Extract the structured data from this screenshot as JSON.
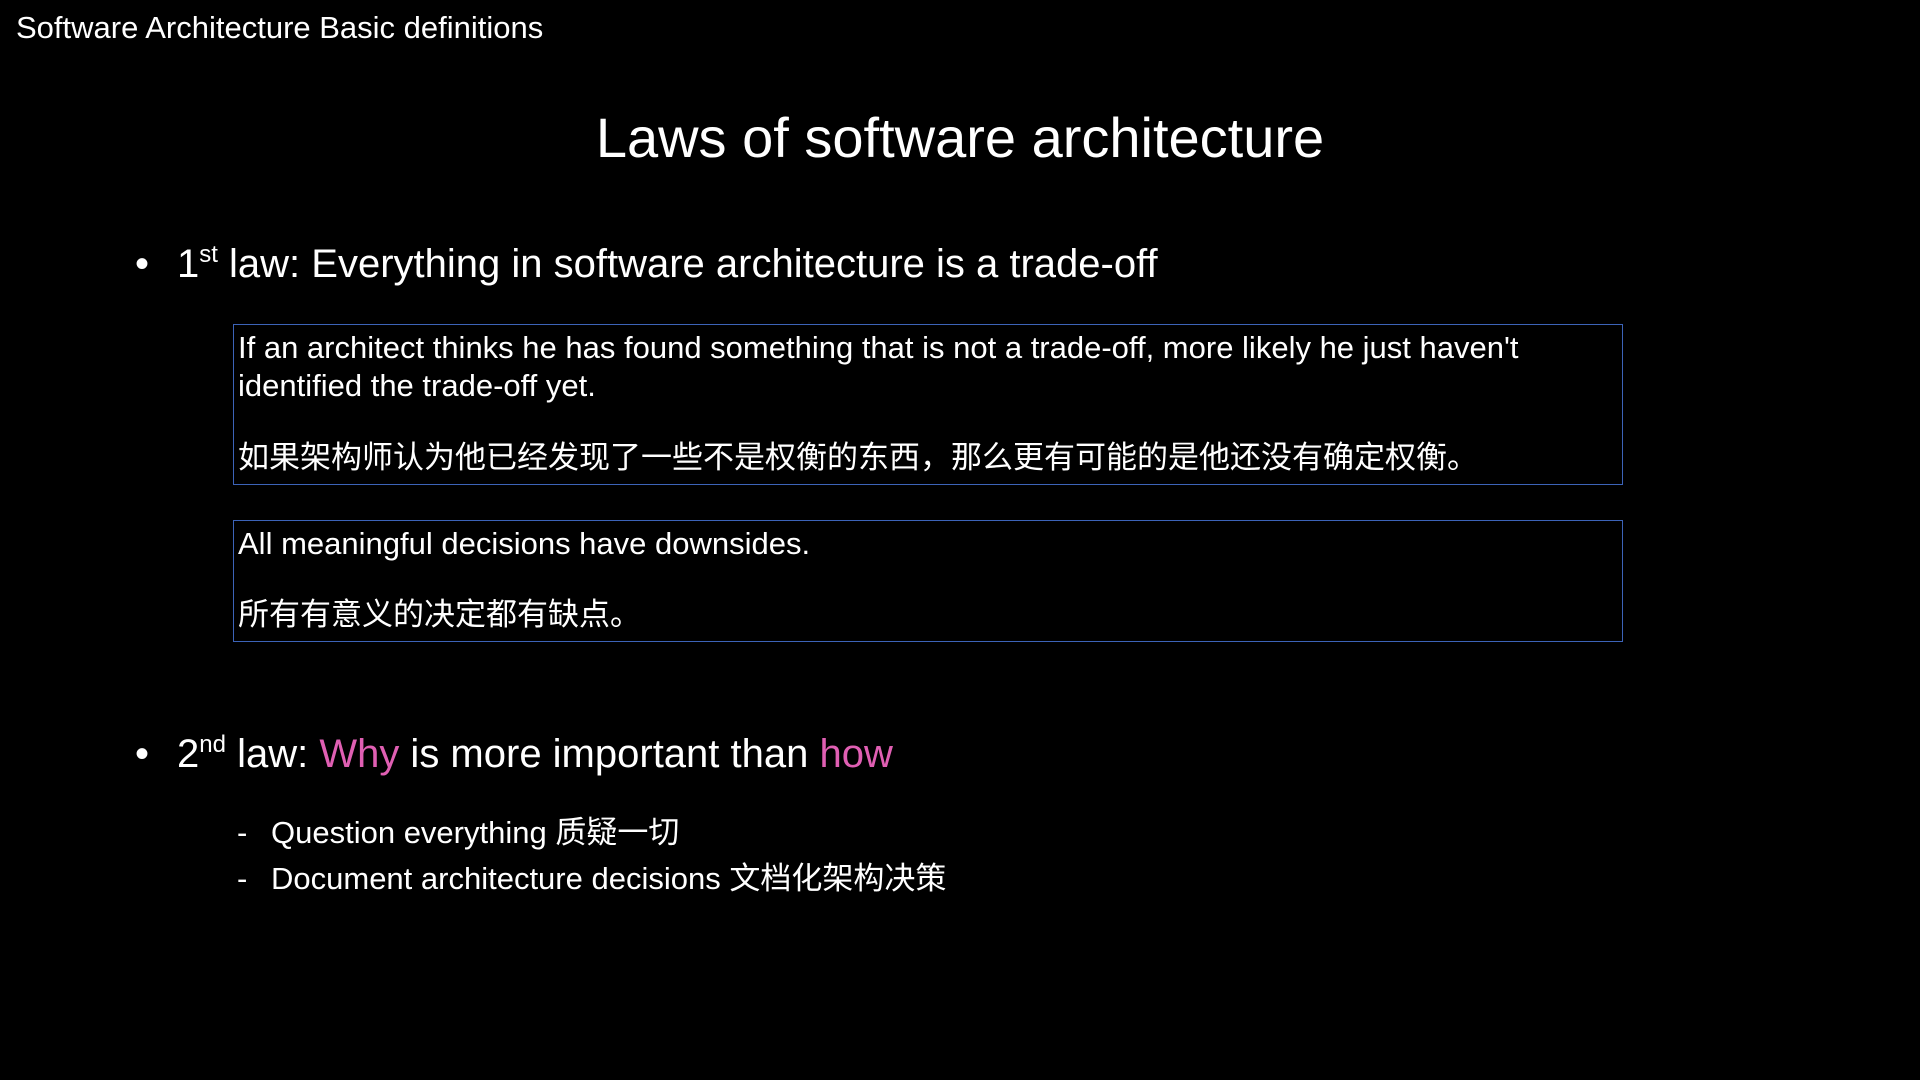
{
  "header": {
    "text": "Software Architecture Basic definitions"
  },
  "title": "Laws of software architecture",
  "law1": {
    "bullet": "•",
    "number": "1",
    "ordinal": "st",
    "text": " law: Everything in software architecture is a trade-off"
  },
  "box1": {
    "english": "If an architect thinks he has found something that is not a trade-off, more likely he just haven't identified the trade-off yet.",
    "english_line1": "If an architect thinks he has found something that is not a trade-off, more likely he just haven't",
    "english_line2": "identified the trade-off yet.",
    "chinese": "如果架构师认为他已经发现了一些不是权衡的东西，那么更有可能的是他还没有确定权衡。"
  },
  "box2": {
    "english": "All meaningful decisions have downsides.",
    "chinese": "所有有意义的决定都有缺点。"
  },
  "law2": {
    "bullet": "•",
    "number": "2",
    "ordinal": "nd",
    "prefix": " law: ",
    "why": "Why",
    "middle": " is more important than ",
    "how": "how",
    "accent_color": "#e05fb3"
  },
  "law2_items": [
    {
      "dash": "-",
      "text": "Question everything 质疑一切"
    },
    {
      "dash": "-",
      "text": "Document architecture decisions 文档化架构决策"
    }
  ],
  "colors": {
    "background": "#000000",
    "text": "#ffffff",
    "box_border": "#3c63b8",
    "accent": "#e05fb3"
  }
}
